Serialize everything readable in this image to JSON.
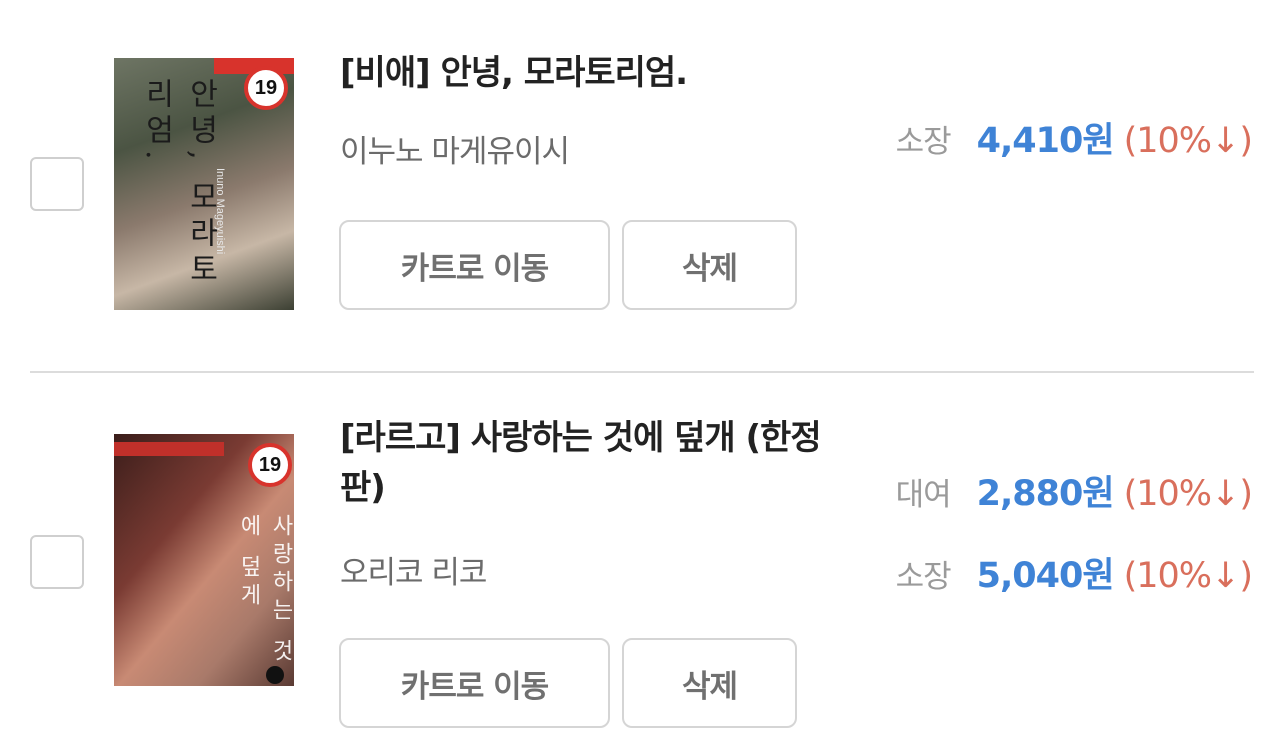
{
  "items": [
    {
      "cover": {
        "age_badge": "19",
        "cover_title": "안녕, 모라토리엄.",
        "cover_author": "Inuno Mageyuishi"
      },
      "title": "[비애] 안녕, 모라토리엄.",
      "author": "이누노 마게유이시",
      "prices": [
        {
          "type": "소장",
          "amount": "4,410원",
          "discount": "(10%↓)"
        }
      ],
      "buttons": {
        "cart": "카트로 이동",
        "delete": "삭제"
      }
    },
    {
      "cover": {
        "age_badge": "19",
        "cover_title": "사랑하는 것에 덮게"
      },
      "title": "[라르고] 사랑하는 것에 덮개 (한정판)",
      "author": "오리코 리코",
      "prices": [
        {
          "type": "대여",
          "amount": "2,880원",
          "discount": "(10%↓)"
        },
        {
          "type": "소장",
          "amount": "5,040원",
          "discount": "(10%↓)"
        }
      ],
      "buttons": {
        "cart": "카트로 이동",
        "delete": "삭제"
      }
    }
  ],
  "colors": {
    "price_accent": "#3f83d6",
    "discount": "#d96f5c",
    "rating_badge": "#d8332c"
  }
}
